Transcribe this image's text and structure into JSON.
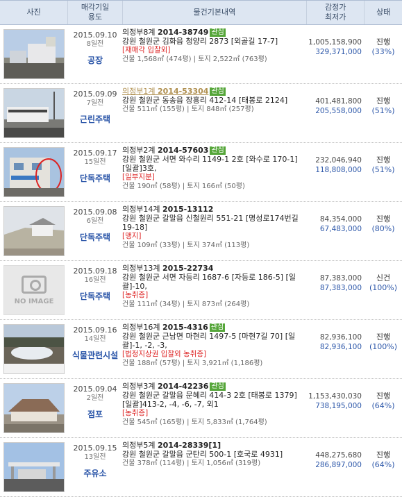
{
  "header": {
    "photo": "사진",
    "date_line1": "매각기일",
    "date_line2": "용도",
    "info": "물건기본내역",
    "price_line1": "감정가",
    "price_line2": "최저가",
    "status": "상태"
  },
  "rows": [
    {
      "date": "2015.09.10",
      "ago": "8일전",
      "use": "공장",
      "court": "의정부8계",
      "case": "2014-38749",
      "badge": "관심",
      "addr": "강원 철원군 김화읍 청양리 2873 [외골길 17-7]",
      "note": "[재매각  입찰외]",
      "area": "건물 1,568㎡ (474평) | 토지 2,522㎡ (763평)",
      "appraisal": "1,005,158,900",
      "minimum": "329,371,000",
      "status": "진행",
      "pct": "(33%)"
    },
    {
      "date": "2015.09.09",
      "ago": "7일전",
      "use": "근린주택",
      "court": "의정부1계",
      "case": "2014-53304",
      "badge": "관심",
      "addr": "강원 철원군 동송읍 장흥리 412-14 [태봉로 2124]",
      "note": "",
      "area": "건물 511㎡ (155평) | 토지 848㎡ (257평)",
      "appraisal": "401,481,800",
      "minimum": "205,558,000",
      "status": "진행",
      "pct": "(51%)"
    },
    {
      "date": "2015.09.17",
      "ago": "15일전",
      "use": "단독주택",
      "court": "의정부2계",
      "case": "2014-57603",
      "badge": "관심",
      "addr": "강원 철원군 서면 와수리 1149-1 2호 [와수로 170-1] [일괄]3호,",
      "note": "[일부지분]",
      "area": "건물 190㎡ (58평) | 토지 166㎡ (50평)",
      "appraisal": "232,046,940",
      "minimum": "118,808,000",
      "status": "진행",
      "pct": "(51%)"
    },
    {
      "date": "2015.09.08",
      "ago": "6일전",
      "use": "단독주택",
      "court": "의정부14계",
      "case": "2015-13112",
      "badge": "",
      "addr": "강원 철원군 갈말읍 신철원리 551-21 [명성로174번길 19-18]",
      "note": "[맹지]",
      "area": "건물 109㎡ (33평) | 토지 374㎡ (113평)",
      "appraisal": "84,354,000",
      "minimum": "67,483,000",
      "status": "진행",
      "pct": "(80%)"
    },
    {
      "date": "2015.09.18",
      "ago": "16일전",
      "use": "단독주택",
      "court": "의정부13계",
      "case": "2015-22734",
      "badge": "",
      "addr": "강원 철원군 서면 자등리 1687-6 [자등로 186-5] [일괄]-10,",
      "note": "[농취증]",
      "area": "건물 111㎡ (34평) | 토지 873㎡ (264평)",
      "appraisal": "87,383,000",
      "minimum": "87,383,000",
      "status": "신건",
      "pct": "(100%)",
      "noimage": "NO IMAGE"
    },
    {
      "date": "2015.09.16",
      "ago": "14일전",
      "use": "식물관련시설",
      "court": "의정부16계",
      "case": "2015-4316",
      "badge": "관심",
      "addr": "강원 철원군 근남면 마현리 1497-5 [마현7길 70] [일괄]-1, -2, -3,",
      "note": "[법정지상권  입찰외  농취증]",
      "area": "건물 188㎡ (57평) | 토지 3,921㎡ (1,186평)",
      "appraisal": "82,936,100",
      "minimum": "82,936,100",
      "status": "진행",
      "pct": "(100%)"
    },
    {
      "date": "2015.09.04",
      "ago": "2일전",
      "use": "점포",
      "court": "의정부3계",
      "case": "2014-42236",
      "badge": "관심",
      "addr": "강원 철원군 갈말읍 문혜리 414-3 2호 [태봉로 1379] [일괄]413-2, -4, -6, -7, 외1",
      "note": "[농취증]",
      "area": "건물 545㎡ (165평) | 토지 5,833㎡ (1,764평)",
      "appraisal": "1,153,430,030",
      "minimum": "738,195,000",
      "status": "진행",
      "pct": "(64%)"
    },
    {
      "date": "2015.09.15",
      "ago": "13일전",
      "use": "주유소",
      "court": "의정부5계",
      "case": "2014-28339[1]",
      "badge": "",
      "addr": "강원 철원군 갈말읍 군탄리 500-1 [호국로 4931]",
      "note": "",
      "area": "건물 378㎡ (114평) | 토지 1,056㎡ (319평)",
      "appraisal": "448,275,680",
      "minimum": "286,897,000",
      "status": "진행",
      "pct": "(64%)"
    }
  ]
}
